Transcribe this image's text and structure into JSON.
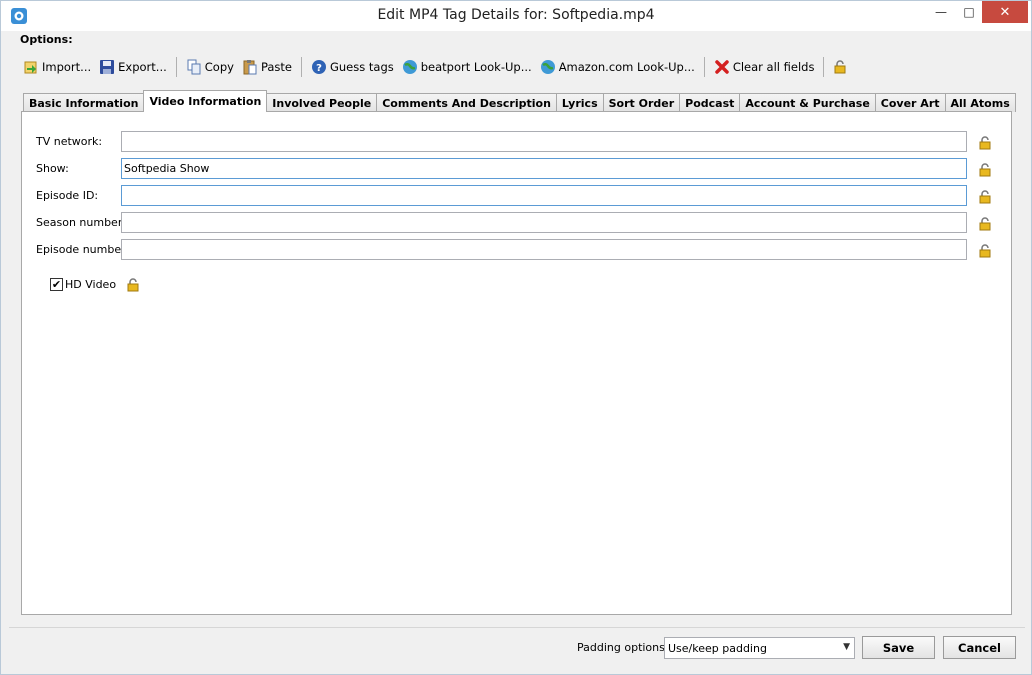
{
  "window": {
    "title": "Edit MP4 Tag Details for: Softpedia.mp4"
  },
  "options_label": "Options:",
  "toolbar": {
    "import": "Import...",
    "export": "Export...",
    "copy": "Copy",
    "paste": "Paste",
    "guess": "Guess tags",
    "beatport": "beatport Look-Up...",
    "amazon": "Amazon.com Look-Up...",
    "clear": "Clear all fields"
  },
  "tabs": [
    "Basic Information",
    "Video Information",
    "Involved People",
    "Comments And Description",
    "Lyrics",
    "Sort Order",
    "Podcast",
    "Account & Purchase",
    "Cover Art",
    "All Atoms"
  ],
  "fields": {
    "tv_network": {
      "label": "TV network:",
      "value": ""
    },
    "show": {
      "label": "Show:",
      "value": "Softpedia Show"
    },
    "episode_id": {
      "label": "Episode ID:",
      "value": ""
    },
    "season_number": {
      "label": "Season number:",
      "value": ""
    },
    "episode_number": {
      "label": "Episode number:",
      "value": ""
    }
  },
  "hd_video": {
    "label": "HD Video",
    "checked": true,
    "mark": "✔"
  },
  "footer": {
    "padding_label": "Padding options:",
    "padding_value": "Use/keep padding",
    "save": "Save",
    "cancel": "Cancel"
  }
}
